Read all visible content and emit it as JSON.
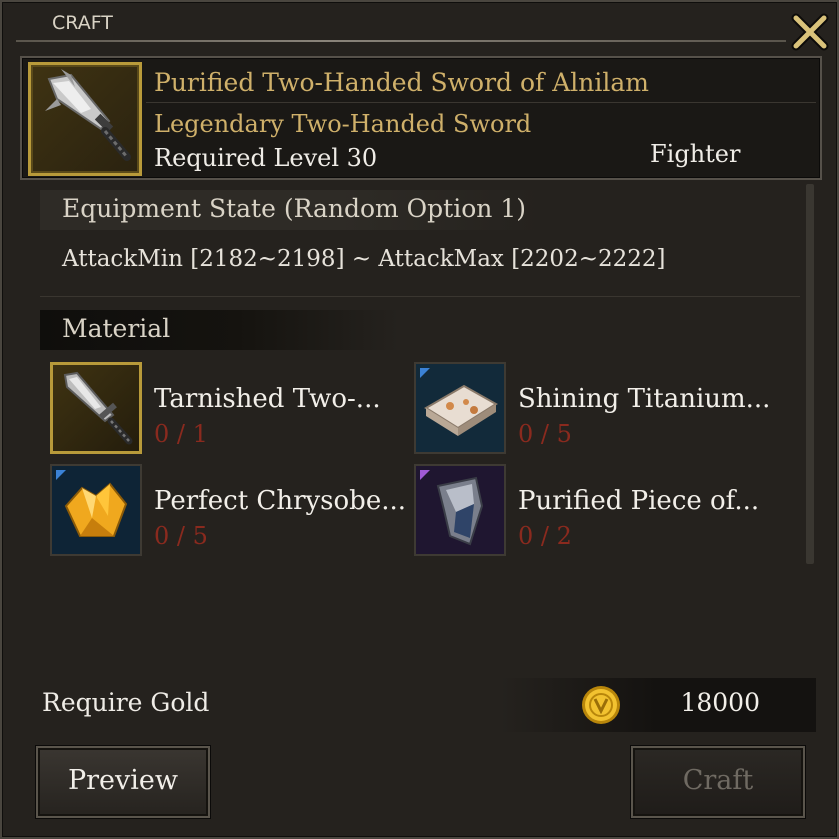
{
  "window": {
    "title": "CRAFT"
  },
  "item": {
    "name": "Purified Two-Handed Sword of Alnilam",
    "type": "Legendary Two-Handed Sword",
    "required_level": "Required Level 30",
    "class": "Fighter",
    "icon": "two-handed-sword-icon"
  },
  "equipment_state": {
    "heading": "Equipment State (Random Option 1)",
    "stats": "AttackMin [2182~2198] ~ AttackMax [2202~2222]"
  },
  "materials": {
    "heading": "Material",
    "items": [
      {
        "name": "Tarnished Two-...",
        "count": "0 / 1",
        "icon": "tarnished-sword-icon"
      },
      {
        "name": "Shining Titanium...",
        "count": "0 / 5",
        "icon": "titanium-ingot-icon"
      },
      {
        "name": "Perfect Chrysobe...",
        "count": "0 / 5",
        "icon": "chrysoberyl-gem-icon"
      },
      {
        "name": "Purified Piece of...",
        "count": "0 / 2",
        "icon": "purified-piece-icon"
      }
    ]
  },
  "gold": {
    "label": "Require Gold",
    "value": "18000",
    "icon": "gold-coin-icon"
  },
  "buttons": {
    "preview": "Preview",
    "craft": "Craft"
  },
  "colors": {
    "item_name": "#cfb06a",
    "insufficient_count": "#8a2a1e",
    "frame_gold": "#b89a3a",
    "grade_blue": "#3b82d6",
    "grade_purple": "#a05ad6"
  }
}
